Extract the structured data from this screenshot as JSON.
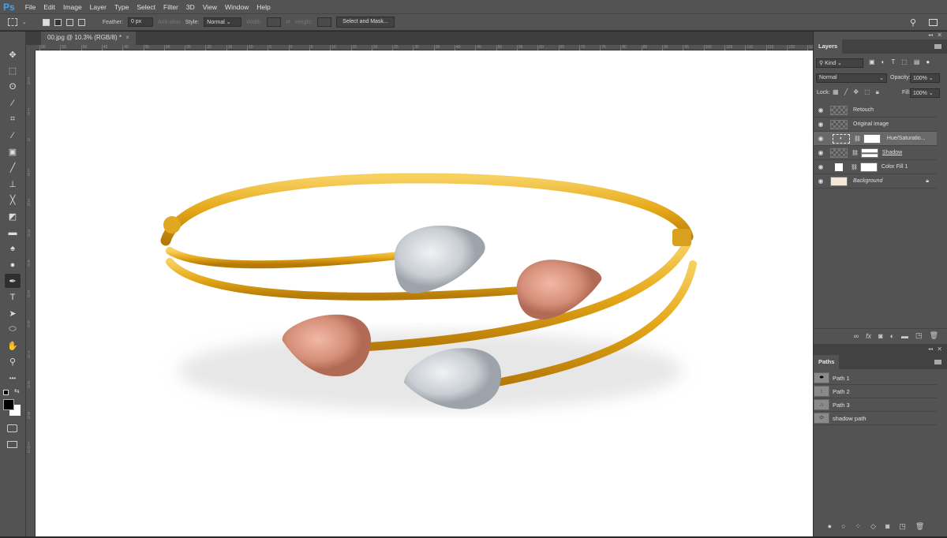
{
  "app": {
    "logo": "Ps"
  },
  "menu": [
    "File",
    "Edit",
    "Image",
    "Layer",
    "Type",
    "Select",
    "Filter",
    "3D",
    "View",
    "Window",
    "Help"
  ],
  "options": {
    "feather_label": "Feather:",
    "feather_value": "0 px",
    "antialias": "Anti-alias",
    "style_label": "Style:",
    "style_value": "Normal",
    "width_label": "Width:",
    "height_label": "Height:",
    "select_mask": "Select and Mask..."
  },
  "document": {
    "tab_title": "00.jpg @ 10.3% (RGB/8) *",
    "close": "×"
  },
  "rulers": {
    "horizontal": [
      "60",
      "55",
      "50",
      "45",
      "40",
      "35",
      "30",
      "25",
      "20",
      "15",
      "10",
      "5",
      "0",
      "5",
      "10",
      "15",
      "20",
      "25",
      "30",
      "35",
      "40",
      "45",
      "50",
      "55",
      "60",
      "65",
      "70",
      "75",
      "80",
      "85",
      "90",
      "95",
      "100",
      "105",
      "110",
      "115",
      "120",
      "125"
    ],
    "vertical": [
      "20",
      "10",
      "0",
      "10",
      "20",
      "30",
      "40",
      "50",
      "60",
      "70",
      "80",
      "90",
      "100"
    ]
  },
  "tools": [
    {
      "name": "move-tool",
      "glyph": "✥"
    },
    {
      "name": "marquee-tool",
      "glyph": "⬚"
    },
    {
      "name": "lasso-tool",
      "glyph": "ʘ"
    },
    {
      "name": "magic-wand-tool",
      "glyph": "⁄"
    },
    {
      "name": "crop-tool",
      "glyph": "⌗"
    },
    {
      "name": "eyedropper-tool",
      "glyph": "⁄"
    },
    {
      "name": "healing-brush-tool",
      "glyph": "▣"
    },
    {
      "name": "brush-tool",
      "glyph": "╱"
    },
    {
      "name": "clone-stamp-tool",
      "glyph": "⊥"
    },
    {
      "name": "history-brush-tool",
      "glyph": "╳"
    },
    {
      "name": "eraser-tool",
      "glyph": "◩"
    },
    {
      "name": "gradient-tool",
      "glyph": "▬"
    },
    {
      "name": "blur-tool",
      "glyph": "♠"
    },
    {
      "name": "dodge-tool",
      "glyph": "●"
    },
    {
      "name": "pen-tool",
      "glyph": "✒",
      "active": true
    },
    {
      "name": "type-tool",
      "glyph": "T"
    },
    {
      "name": "path-selection-tool",
      "glyph": "➤"
    },
    {
      "name": "ellipse-tool",
      "glyph": "⬭"
    },
    {
      "name": "hand-tool",
      "glyph": "✋"
    },
    {
      "name": "zoom-tool",
      "glyph": "⚲"
    },
    {
      "name": "more-tools",
      "glyph": "•••"
    }
  ],
  "colors": {
    "foreground": "#000000",
    "background": "#ffffff",
    "gold": "#e8b020",
    "silver": "#d4d8dc",
    "rose": "#dc9a86"
  },
  "layers_panel": {
    "tab": "Layers",
    "filter": "Kind",
    "blend_mode": "Normal",
    "opacity_label": "Opacity:",
    "opacity_value": "100%",
    "lock_label": "Lock:",
    "fill_label": "Fill:",
    "fill_value": "100%",
    "layers": [
      {
        "name": "Retouch",
        "visible": true
      },
      {
        "name": "Original image",
        "visible": true
      },
      {
        "name": "Hue/Saturatio...",
        "visible": true,
        "selected": true
      },
      {
        "name": "Shadow",
        "visible": true
      },
      {
        "name": "Color Fill 1",
        "visible": true
      },
      {
        "name": "Background",
        "visible": true,
        "locked": true
      }
    ]
  },
  "paths_panel": {
    "tab": "Paths",
    "paths": [
      {
        "name": "Path 1"
      },
      {
        "name": "Path 2"
      },
      {
        "name": "Path 3"
      },
      {
        "name": "shadow path"
      }
    ]
  }
}
